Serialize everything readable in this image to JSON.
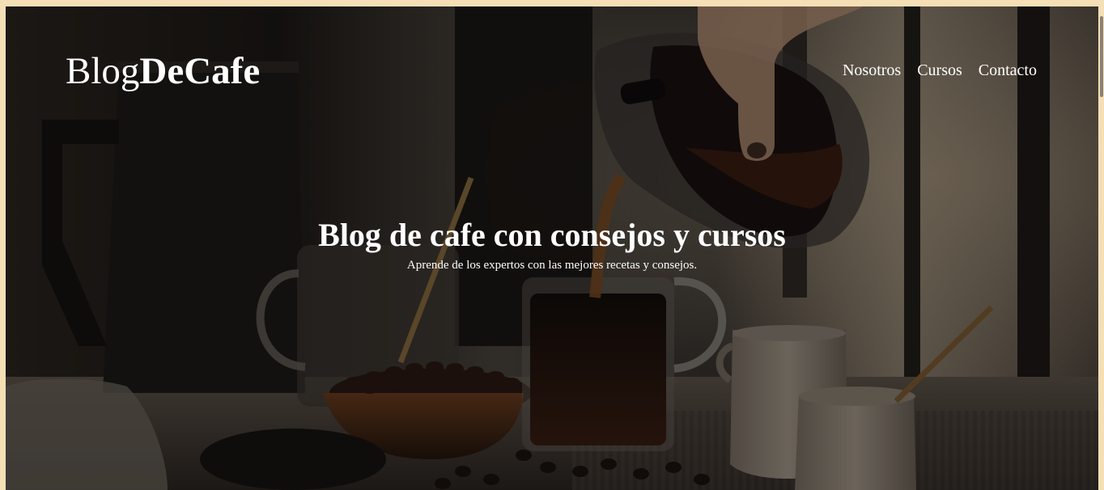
{
  "page": {
    "logo": {
      "regular": "Blog",
      "bold": "DeCafe"
    },
    "nav": {
      "items": [
        {
          "label": "Nosotros"
        },
        {
          "label": "Cursos"
        },
        {
          "label": "Contacto"
        }
      ]
    },
    "hero": {
      "title": "Blog de cafe con consejos y cursos",
      "subtitle": "Aprende de los expertos con las mejores recetas y consejos."
    },
    "colors": {
      "page_border": "#f4dfb6",
      "text": "#ffffff",
      "overlay": "rgba(0,0,0,0.35)"
    },
    "icons": {
      "scrollbar": "scrollbar-icon"
    }
  }
}
